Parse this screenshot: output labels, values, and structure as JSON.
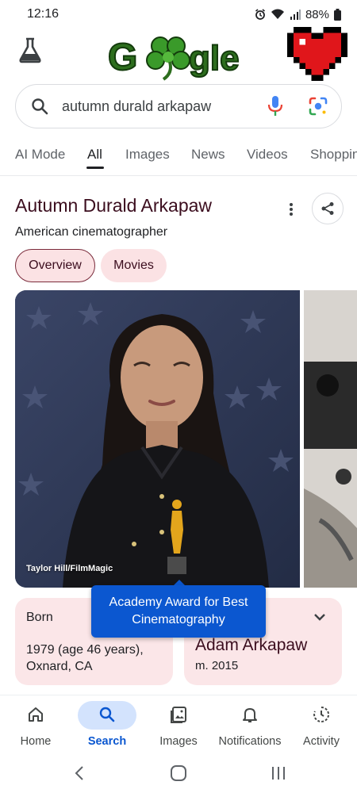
{
  "status_bar": {
    "time": "12:16",
    "battery": "88%"
  },
  "header": {
    "labs_icon": "flask-icon",
    "logo_text": "Google"
  },
  "search": {
    "query": "autumn durald arkapaw"
  },
  "tabs": [
    "AI Mode",
    "All",
    "Images",
    "News",
    "Videos",
    "Shoppin"
  ],
  "active_tab": "All",
  "knowledge_panel": {
    "title": "Autumn Durald Arkapaw",
    "subtitle": "American cinematographer",
    "chips": [
      "Overview",
      "Movies"
    ],
    "image_credit": "Taylor Hill/FilmMagic"
  },
  "born": {
    "label": "Born",
    "value": "1979 (age 46 years), Oxnard, CA"
  },
  "spouse": {
    "name": "Adam Arkapaw",
    "meta": "m. 2015"
  },
  "tooltip": "Academy Award for Best Cinematography",
  "bottom_nav": [
    {
      "label": "Home",
      "icon": "home-icon"
    },
    {
      "label": "Search",
      "icon": "search-icon"
    },
    {
      "label": "Images",
      "icon": "images-icon"
    },
    {
      "label": "Notifications",
      "icon": "bell-icon"
    },
    {
      "label": "Activity",
      "icon": "activity-icon"
    }
  ],
  "colors": {
    "accent_blue": "#0b57d0",
    "chip_pink": "#fbe2e4",
    "title_maroon": "#3b0d1e",
    "nav_pill": "#d3e3fd"
  }
}
